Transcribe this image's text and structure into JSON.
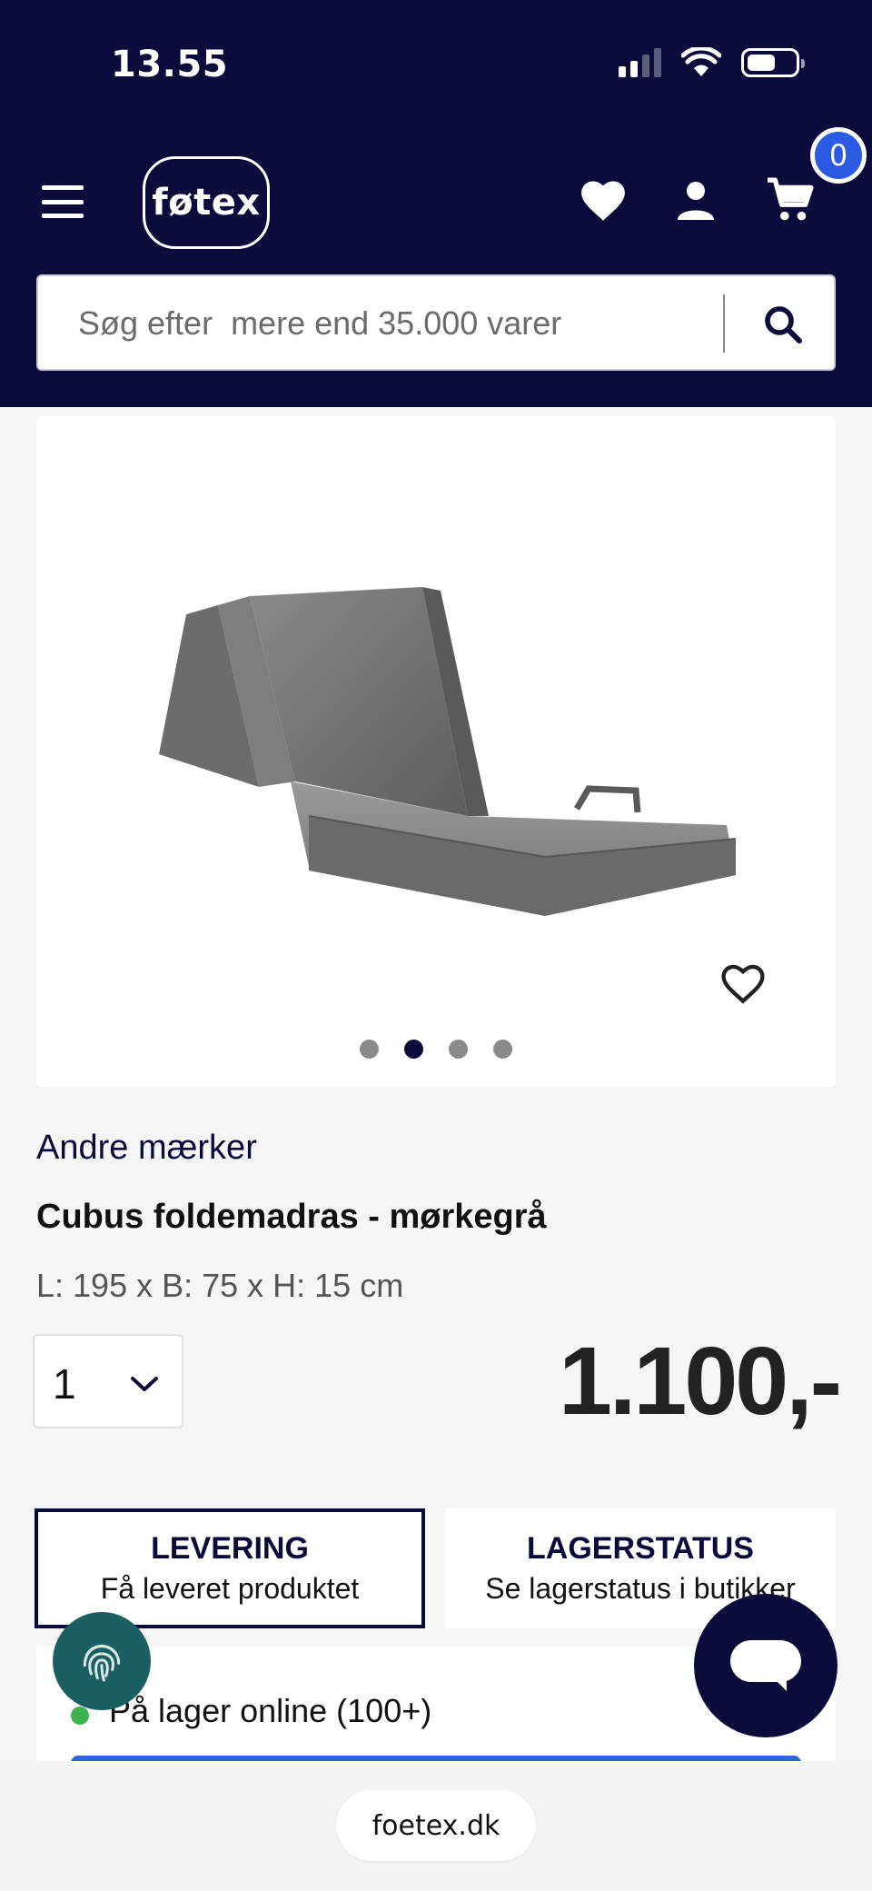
{
  "status_bar": {
    "time": "13.55"
  },
  "header": {
    "logo_text": "føtex",
    "cart_count": "0",
    "icons": [
      "menu-icon",
      "heart-icon",
      "user-icon",
      "cart-icon"
    ]
  },
  "search": {
    "placeholder": "Søg efter  mere end 35.000 varer",
    "icon": "search-icon"
  },
  "gallery": {
    "image": "folding-mattress",
    "slide_count": 4,
    "active_slide": 2
  },
  "product": {
    "brand": "Andre mærker",
    "title": "Cubus foldemadras - mørkegrå",
    "dimensions": "L: 195 x B: 75 x H: 15 cm",
    "quantity": "1",
    "price": "1.100,-"
  },
  "tabs": [
    {
      "title": "LEVERING",
      "subtitle": "Få leveret produktet",
      "active": true
    },
    {
      "title": "LAGERSTATUS",
      "subtitle": "Se lagerstatus i butikker",
      "active": false
    }
  ],
  "stock": {
    "text": "På lager online (100+)",
    "color": "#3cb24c"
  },
  "browser": {
    "url": "foetex.dk"
  },
  "colors": {
    "navy": "#0a0b3b",
    "blue": "#2f63e6",
    "teal": "#1b5f62",
    "badge": "#2b5be3"
  }
}
